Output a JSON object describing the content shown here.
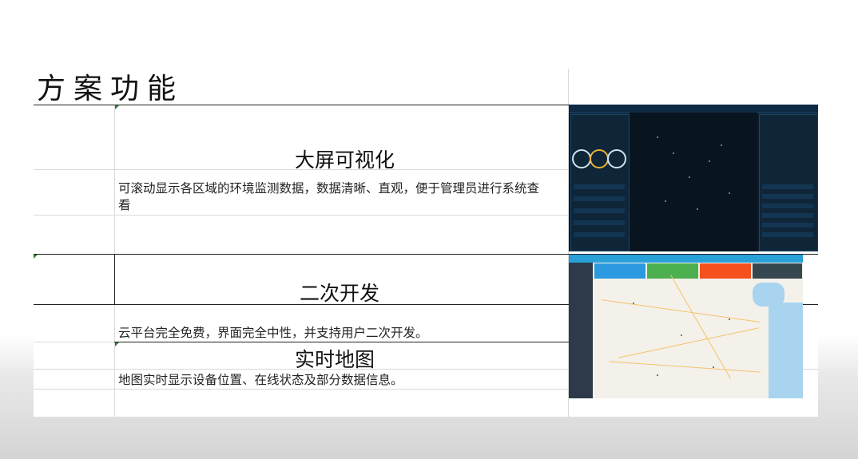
{
  "page": {
    "title": "方案功能",
    "sections": [
      {
        "heading": "大屏可视化",
        "description": "可滚动显示各区域的环境监测数据，数据清晰、直观，便于管理员进行系统查看"
      },
      {
        "heading": "二次开发",
        "description": "云平台完全免费，界面完全中性，并支持用户二次开发。"
      },
      {
        "heading": "实时地图",
        "description": "地图实时显示设备位置、在线状态及部分数据信息。"
      }
    ]
  },
  "images": {
    "dashboard": {
      "name": "dashboard-screenshot",
      "accent": "#0b1c2c"
    },
    "map": {
      "name": "map-screenshot",
      "cards": [
        "#2b9ae0",
        "#4caf50",
        "#f4511e",
        "#37474f"
      ]
    }
  },
  "colors": {
    "border_dark": "#222222",
    "grid": "#d9d9d9",
    "marker": "#2e7d32"
  }
}
